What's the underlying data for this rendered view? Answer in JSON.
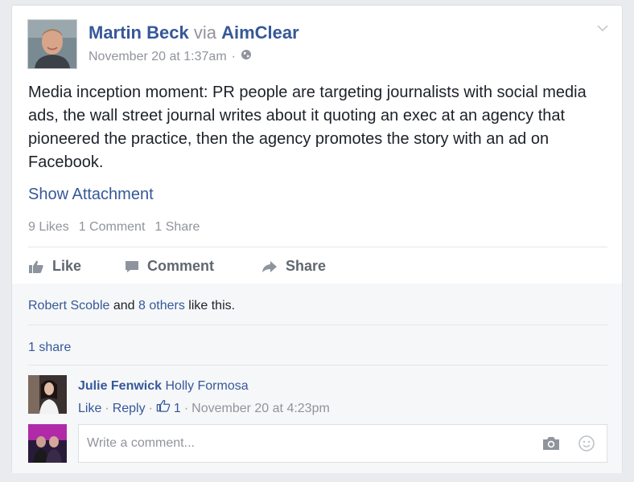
{
  "post": {
    "author": "Martin Beck",
    "via": "via",
    "page": "AimClear",
    "timestamp": "November 20 at 1:37am",
    "separator": "·",
    "text": "Media inception moment: PR people are targeting journalists with social media ads, the wall street journal writes about it quoting an exec at an agency that pioneered the practice, then the agency promotes the story with an ad on Facebook.",
    "show_attachment": "Show Attachment"
  },
  "stats": {
    "likes": "9 Likes",
    "comments": "1 Comment",
    "shares": "1 Share"
  },
  "actions": {
    "like": "Like",
    "comment": "Comment",
    "share": "Share"
  },
  "feedback": {
    "likers_name": "Robert Scoble",
    "and": "and",
    "others": "8 others",
    "like_this": "like this.",
    "share_count": "1 share"
  },
  "comment": {
    "author": "Julie Fenwick",
    "text": "Holly Formosa",
    "like": "Like",
    "reply": "Reply",
    "sep": "·",
    "like_count": "1",
    "timestamp": "November 20 at 4:23pm"
  },
  "composer": {
    "placeholder": "Write a comment..."
  },
  "colors": {
    "link": "#365899",
    "muted": "#90949c",
    "text": "#1d2129",
    "background": "#e9ebee"
  }
}
